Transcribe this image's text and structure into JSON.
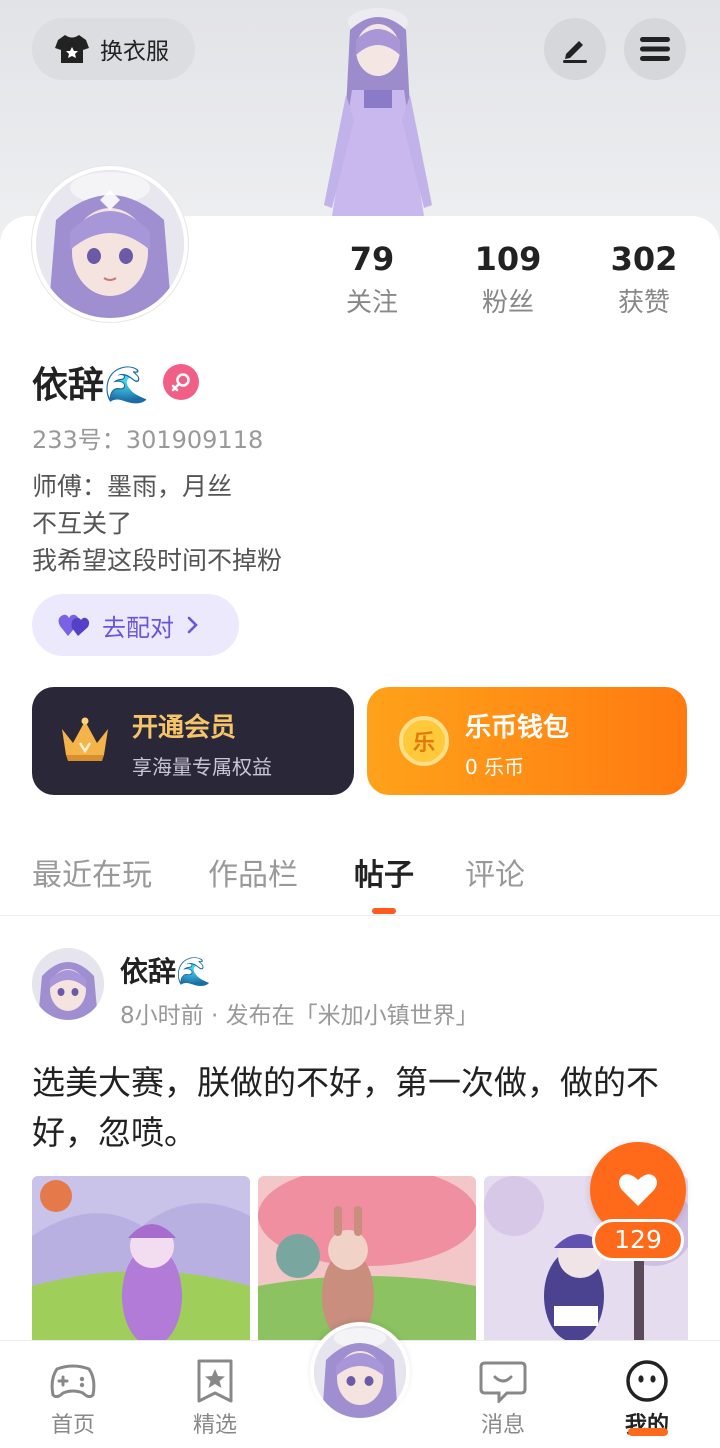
{
  "header": {
    "outfit_button_label": "换衣服",
    "edit_icon": "pencil-icon",
    "menu_icon": "hamburger-menu-icon"
  },
  "profile": {
    "stats": [
      {
        "value": "79",
        "label": "关注"
      },
      {
        "value": "109",
        "label": "粉丝"
      },
      {
        "value": "302",
        "label": "获赞"
      }
    ],
    "name": "依辞🌊",
    "gender_icon": "female-icon",
    "uid": "233号：301909118",
    "bio": [
      "师傅：墨雨，月丝",
      "不互关了",
      "我希望这段时间不掉粉"
    ],
    "pair_button_label": "去配对"
  },
  "vip": {
    "title": "开通会员",
    "subtitle": "享海量专属权益"
  },
  "wallet": {
    "title": "乐币钱包",
    "subtitle": "0 乐币",
    "coin_char": "乐"
  },
  "tabs": [
    {
      "label": "最近在玩",
      "active": false
    },
    {
      "label": "作品栏",
      "active": false
    },
    {
      "label": "帖子",
      "active": true
    },
    {
      "label": "评论",
      "active": false
    }
  ],
  "post": {
    "author": "依辞🌊",
    "meta": "8小时前 · 发布在「米加小镇世界」",
    "text": "选美大赛，朕做的不好，第一次做，做的不好，忽喷。",
    "likes": "129"
  },
  "bottom_nav": [
    {
      "label": "首页",
      "icon": "gamepad-icon"
    },
    {
      "label": "精选",
      "icon": "star-badge-icon"
    },
    {
      "label": "消息",
      "icon": "chat-bubble-icon"
    },
    {
      "label": "我的",
      "icon": "smiley-face-icon",
      "active": true
    }
  ],
  "colors": {
    "accent": "#ff6a1a",
    "pair_purple": "#6a56d8",
    "vip_gold": "#f5c56a",
    "female_pink": "#f25f86"
  }
}
